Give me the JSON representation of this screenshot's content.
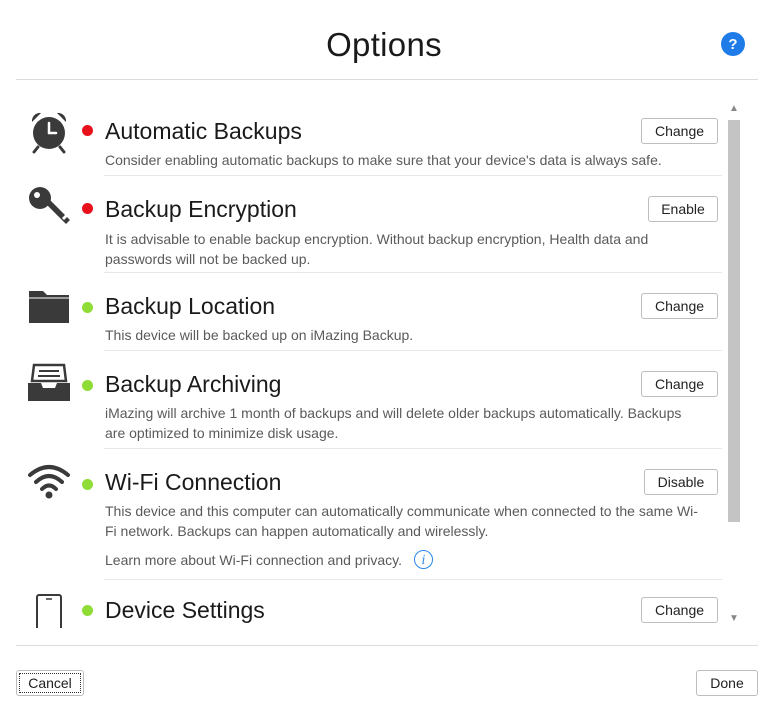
{
  "header": {
    "title": "Options",
    "help_label": "?"
  },
  "rows": [
    {
      "title": "Automatic Backups",
      "status": "red",
      "button": "Change",
      "desc": "Consider enabling automatic backups to make sure that your device's data is always safe."
    },
    {
      "title": "Backup Encryption",
      "status": "red",
      "button": "Enable",
      "desc": "It is advisable to enable backup encryption. Without backup encryption, Health data and passwords will not be backed up."
    },
    {
      "title": "Backup Location",
      "status": "green",
      "button": "Change",
      "desc": "This device will be backed up on iMazing Backup."
    },
    {
      "title": "Backup Archiving",
      "status": "green",
      "button": "Change",
      "desc": "iMazing will archive 1 month of backups and will delete older backups automatically. Backups are optimized to minimize disk usage."
    },
    {
      "title": "Wi-Fi Connection",
      "status": "green",
      "button": "Disable",
      "desc": "This device and this computer can automatically communicate when connected to the same Wi-Fi network. Backups can happen automatically and wirelessly.",
      "link": "Learn more about Wi-Fi connection and privacy."
    },
    {
      "title": "Device Settings",
      "status": "green",
      "button": "Change"
    }
  ],
  "footer": {
    "cancel_label": "Cancel",
    "done_label": "Done"
  },
  "colors": {
    "status_red": "#e8101a",
    "status_green": "#8fdc37",
    "accent": "#1e7be8"
  }
}
